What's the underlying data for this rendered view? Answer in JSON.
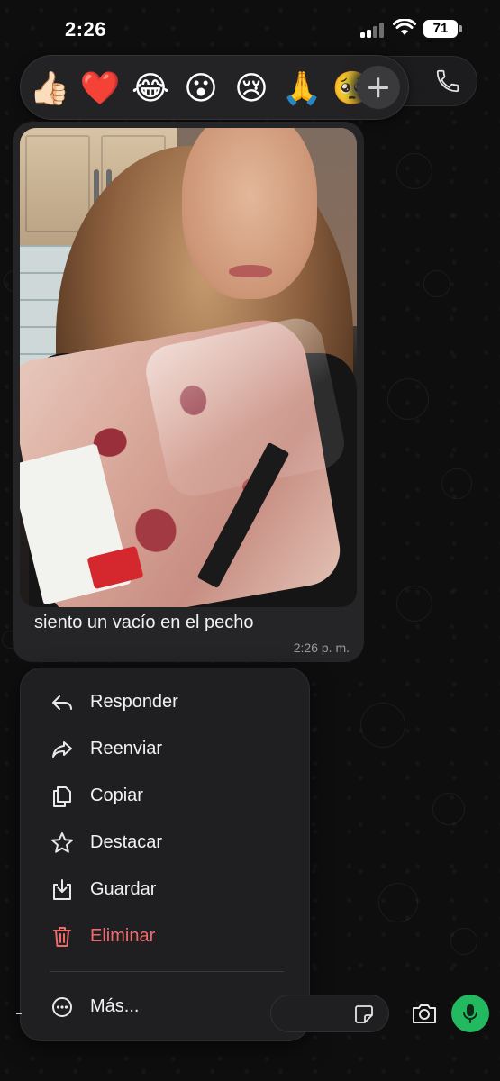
{
  "status_bar": {
    "time": "2:26",
    "battery": "71"
  },
  "reactions": [
    {
      "emoji": "👍🏻",
      "name": "thumbs-up"
    },
    {
      "emoji": "❤️",
      "name": "red-heart"
    },
    {
      "emoji": "😂",
      "name": "tears-of-joy"
    },
    {
      "emoji": "😮",
      "name": "surprised"
    },
    {
      "emoji": "😢",
      "name": "crying"
    },
    {
      "emoji": "🙏",
      "name": "folded-hands"
    },
    {
      "emoji": "🥺",
      "name": "pleading"
    }
  ],
  "message": {
    "caption": "siento un vacío en el pecho",
    "time": "2:26 p. m."
  },
  "menu": {
    "reply": "Responder",
    "forward": "Reenviar",
    "copy": "Copiar",
    "star": "Destacar",
    "save": "Guardar",
    "delete": "Eliminar",
    "more": "Más..."
  },
  "colors": {
    "accent_green": "#23b960",
    "danger_red": "#ef6b6b",
    "bubble": "#252527",
    "menu_bg": "#1f1f21"
  }
}
